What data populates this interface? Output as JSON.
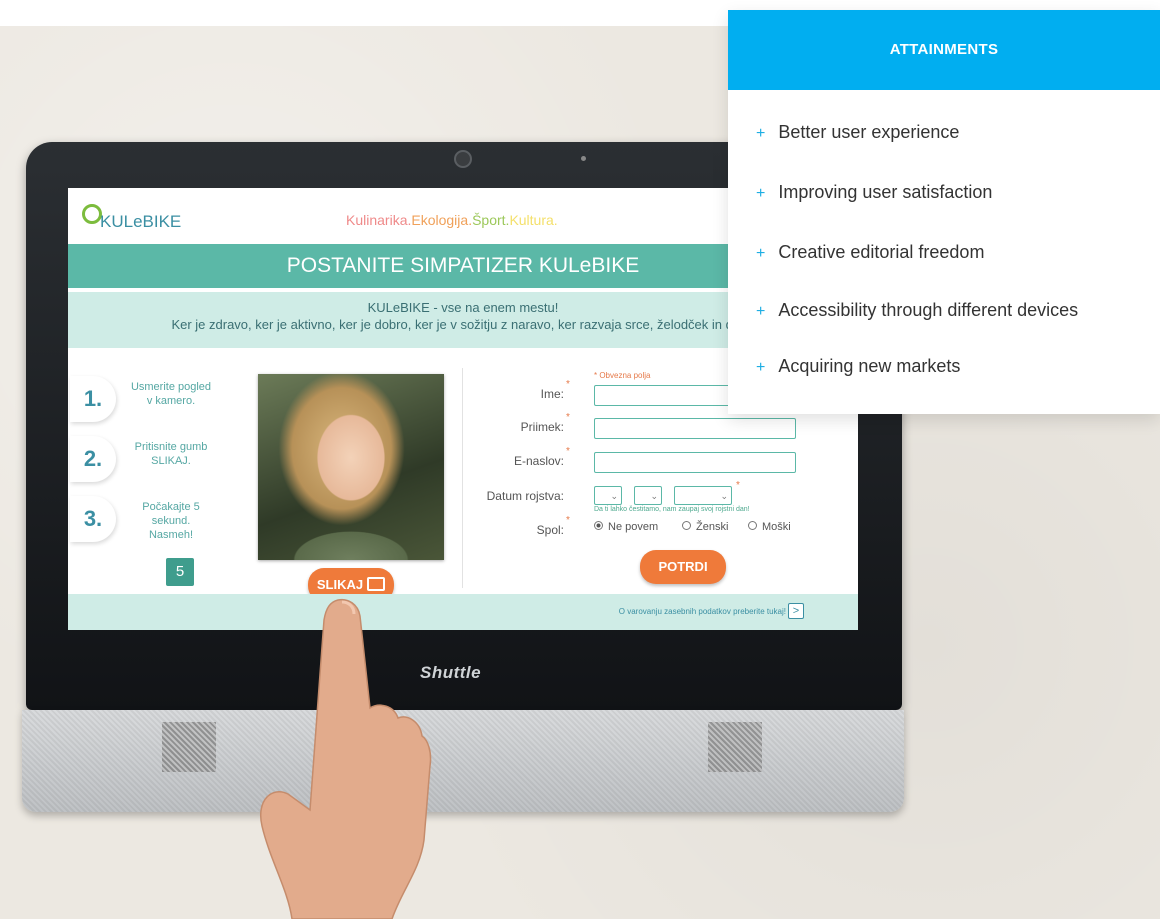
{
  "kiosk": {
    "logo": "KULeBIKE",
    "tagline": {
      "part1": "Kulinarika.",
      "part2": "Ekologija.",
      "part3": "Šport.",
      "part4": "Kultura."
    },
    "title": "POSTANITE SIMPATIZER KULeBIKE",
    "intro_line1": "KULeBIKE - vse na enem mestu!",
    "intro_line2": "Ker je zdravo, ker je aktivno, ker je dobro, ker je v sožitju z naravo, ker razvaja srce, želodček in duha",
    "steps": [
      {
        "number": "1.",
        "line1": "Usmerite pogled",
        "line2": "v kamero."
      },
      {
        "number": "2.",
        "line1": "Pritisnite gumb",
        "line2": "SLIKAJ."
      },
      {
        "number": "3.",
        "line1": "Počakajte 5 sekund.",
        "line2": "Nasmeh!"
      }
    ],
    "countdown": "5",
    "capture_button": "SLIKAJ",
    "required_note": "* Obvezna polja",
    "form": {
      "name_label": "Ime:",
      "surname_label": "Priimek:",
      "email_label": "E-naslov:",
      "birth_label": "Datum rojstva:",
      "birth_note": "Da ti lahko čestitamo, nam zaupaj svoj rojstni dan!",
      "gender_label": "Spol:",
      "gender_options": [
        "Ne povem",
        "Ženski",
        "Moški"
      ],
      "gender_selected": "Ne povem",
      "submit": "POTRDI"
    },
    "privacy_text": "O varovanju zasebnih podatkov preberite tukaj!",
    "monitor_brand": "Shuttle"
  },
  "attainments": {
    "heading": "ATTAINMENTS",
    "items": [
      "Better user experience",
      "Improving user satisfaction",
      "Creative editorial freedom",
      "Accessibility through different devices",
      "Acquiring new markets"
    ]
  }
}
